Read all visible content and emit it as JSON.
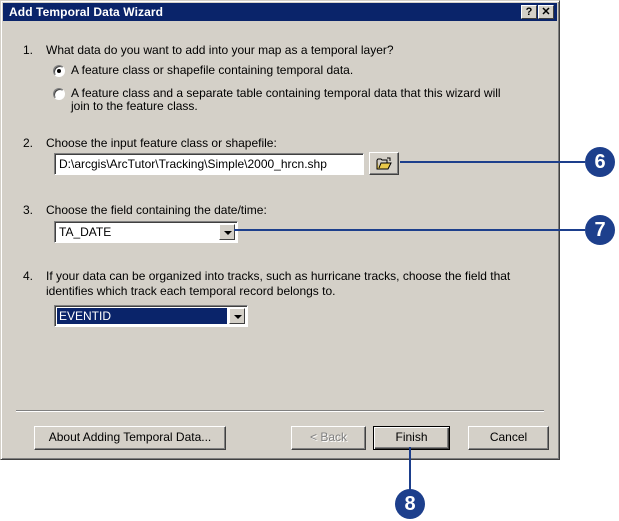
{
  "window": {
    "title": "Add Temporal Data Wizard",
    "help_glyph": "?",
    "close_glyph": "✕"
  },
  "q1": {
    "number": "1.",
    "text": "What data do you want to add into your map as a temporal layer?",
    "option1": "A feature class or shapefile containing temporal data.",
    "option2_line1": "A feature class and a separate table containing temporal data that this wizard will",
    "option2_line2": "join to the feature class."
  },
  "q2": {
    "number": "2.",
    "text": "Choose the input feature class or shapefile:",
    "path_value": "D:\\arcgis\\ArcTutor\\Tracking\\Simple\\2000_hrcn.shp"
  },
  "q3": {
    "number": "3.",
    "text": "Choose the field containing the date/time:",
    "selected": "TA_DATE"
  },
  "q4": {
    "number": "4.",
    "text_line1": "If your data can be organized into tracks, such as hurricane tracks, choose the field that",
    "text_line2": "identifies which track each temporal record belongs to.",
    "selected": "EVENTID"
  },
  "buttons": {
    "about": "About Adding Temporal Data...",
    "back": "< Back",
    "finish": "Finish",
    "cancel": "Cancel"
  },
  "callouts": {
    "c6": "6",
    "c7": "7",
    "c8": "8"
  },
  "colors": {
    "titlebar": "#0a246a",
    "callout": "#1d3f8c",
    "dialog_bg": "#d4d0c8"
  }
}
